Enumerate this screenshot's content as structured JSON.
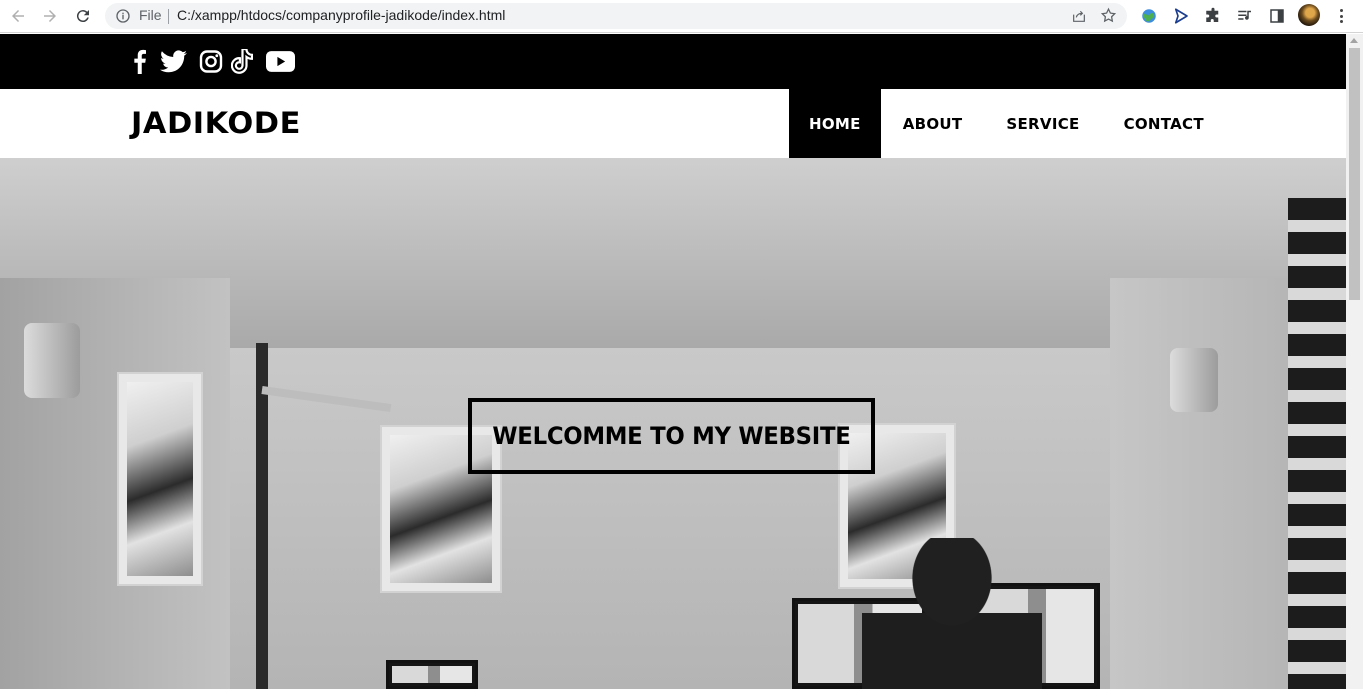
{
  "browser": {
    "omnibox_label": "File",
    "url": "C:/xampp/htdocs/companyprofile-jadikode/index.html",
    "icons": [
      "back-icon",
      "forward-icon",
      "reload-icon",
      "info-icon",
      "share-icon",
      "star-icon",
      "extension-globe-icon",
      "extension-send-icon",
      "extensions-puzzle-icon",
      "media-queue-icon",
      "side-panel-icon",
      "profile-avatar",
      "menu-icon"
    ]
  },
  "topbar": {
    "social_icons": [
      "facebook-icon",
      "twitter-icon",
      "instagram-icon",
      "tiktok-icon",
      "youtube-icon"
    ],
    "background": "#000000"
  },
  "header": {
    "logo": "JADIKODE",
    "menu": [
      {
        "label": "HOME",
        "active": true
      },
      {
        "label": "ABOUT",
        "active": false
      },
      {
        "label": "SERVICE",
        "active": false
      },
      {
        "label": "CONTACT",
        "active": false
      }
    ]
  },
  "hero": {
    "welcome": "WELCOMME TO MY WEBSITE"
  }
}
